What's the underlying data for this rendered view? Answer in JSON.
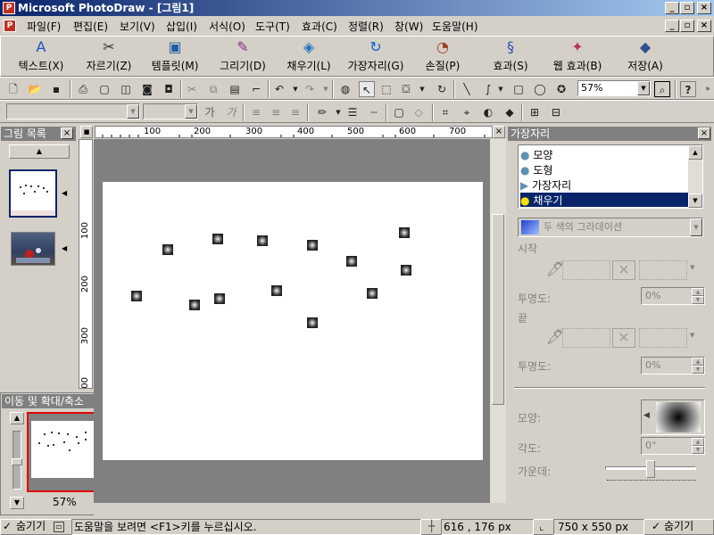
{
  "window": {
    "title": "Microsoft PhotoDraw - [그림1]",
    "min": "_",
    "restore": "▫",
    "close": "×"
  },
  "menu": [
    "파일(F)",
    "편집(E)",
    "보기(V)",
    "삽입(I)",
    "서식(O)",
    "도구(T)",
    "효과(C)",
    "정렬(R)",
    "창(W)",
    "도움말(H)"
  ],
  "bigbar": [
    {
      "label": "텍스트(X)",
      "icon": "A",
      "color": "#2050c0"
    },
    {
      "label": "자르기(Z)",
      "icon": "✂",
      "color": "#303030"
    },
    {
      "label": "템플릿(M)",
      "icon": "▣",
      "color": "#2060a0"
    },
    {
      "label": "그리기(D)",
      "icon": "✎",
      "color": "#803080"
    },
    {
      "label": "채우기(L)",
      "icon": "◈",
      "color": "#2070c0"
    },
    {
      "label": "가장자리(G)",
      "icon": "↻",
      "color": "#1060d0"
    },
    {
      "label": "손질(P)",
      "icon": "◔",
      "color": "#a04020"
    },
    {
      "label": "효과(S)",
      "icon": "§",
      "color": "#3050b0"
    },
    {
      "label": "웹 효과(B)",
      "icon": "✦",
      "color": "#c03060"
    },
    {
      "label": "저장(A)",
      "icon": "◆",
      "color": "#305090"
    }
  ],
  "zoom": {
    "value": "57%"
  },
  "toolbar2": {
    "font_bold": "가",
    "font_italic": "가"
  },
  "left_panel": {
    "title": "그림 목록"
  },
  "pan_zoom": {
    "title": "이동 및 확대/축소",
    "zoom_label": "57%"
  },
  "ruler": {
    "h_labels": [
      "100",
      "200",
      "300",
      "400",
      "500",
      "600",
      "700"
    ],
    "v_labels": [
      "100",
      "200",
      "300",
      "400"
    ]
  },
  "right_panel": {
    "title": "가장자리",
    "list": [
      "모양",
      "도형",
      "가장자리",
      "채우기"
    ],
    "selected_index": 3,
    "fill_type": "두 색의 그라데이션",
    "start_label": "시작",
    "opacity_label": "투명도:",
    "start_opacity": "0%",
    "end_label": "끝",
    "end_opacity": "0%",
    "shape_label": "모양:",
    "angle_label": "각도:",
    "angle_value": "0°",
    "center_label": "가운데:"
  },
  "status": {
    "hide_label": "숨기기",
    "help_text": "도움말을 보려면 <F1>키를 누르십시오.",
    "coords": "616 , 176  px",
    "size": "750 x 550  px",
    "hide_label2": "숨기기"
  }
}
